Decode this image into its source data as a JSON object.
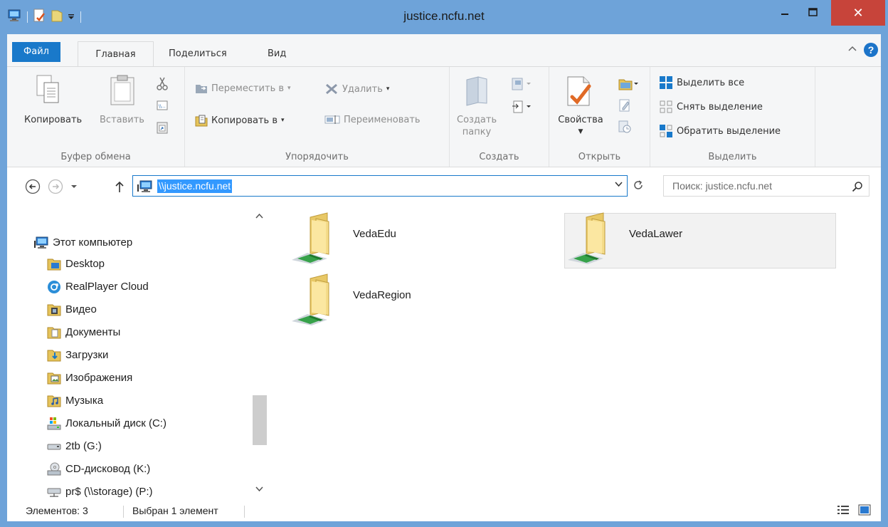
{
  "window": {
    "title": "justice.ncfu.net",
    "close_glyph": "✕"
  },
  "tabs": {
    "file": "Файл",
    "home": "Главная",
    "share": "Поделиться",
    "view": "Вид"
  },
  "ribbon": {
    "clipboard": {
      "copy": "Копировать",
      "paste": "Вставить",
      "label": "Буфер обмена"
    },
    "organize": {
      "move_to": "Переместить в",
      "copy_to": "Копировать в",
      "delete": "Удалить",
      "rename": "Переименовать",
      "label": "Упорядочить"
    },
    "new": {
      "new_folder_1": "Создать",
      "new_folder_2": "папку",
      "label": "Создать"
    },
    "open": {
      "properties": "Свойства",
      "label": "Открыть"
    },
    "select": {
      "select_all": "Выделить все",
      "select_none": "Снять выделение",
      "invert": "Обратить выделение",
      "label": "Выделить"
    }
  },
  "address": {
    "path": "\\\\justice.ncfu.net"
  },
  "search": {
    "placeholder": "Поиск: justice.ncfu.net"
  },
  "nav_tree": {
    "root": "Этот компьютер",
    "items": [
      {
        "label": "Desktop",
        "icon": "desktop-icon"
      },
      {
        "label": "RealPlayer Cloud",
        "icon": "realplayer-cloud-icon"
      },
      {
        "label": "Видео",
        "icon": "video-folder-icon"
      },
      {
        "label": "Документы",
        "icon": "documents-folder-icon"
      },
      {
        "label": "Загрузки",
        "icon": "downloads-folder-icon"
      },
      {
        "label": "Изображения",
        "icon": "pictures-folder-icon"
      },
      {
        "label": "Музыка",
        "icon": "music-folder-icon"
      },
      {
        "label": "Локальный диск (C:)",
        "icon": "local-disk-icon"
      },
      {
        "label": "2tb (G:)",
        "icon": "drive-icon"
      },
      {
        "label": "CD-дисковод (K:)",
        "icon": "cd-drive-icon"
      },
      {
        "label": "pr$ (\\\\storage) (P:)",
        "icon": "network-drive-icon"
      }
    ]
  },
  "folders": [
    {
      "name": "VedaEdu",
      "selected": false
    },
    {
      "name": "VedaLawer",
      "selected": true
    },
    {
      "name": "VedaRegion",
      "selected": false
    }
  ],
  "status": {
    "count": "Элементов: 3",
    "selected": "Выбран 1 элемент"
  },
  "colors": {
    "titlebar": "#6ea3d9",
    "accent": "#1979ca",
    "close": "#c7443a",
    "selection": "#3399ff"
  }
}
